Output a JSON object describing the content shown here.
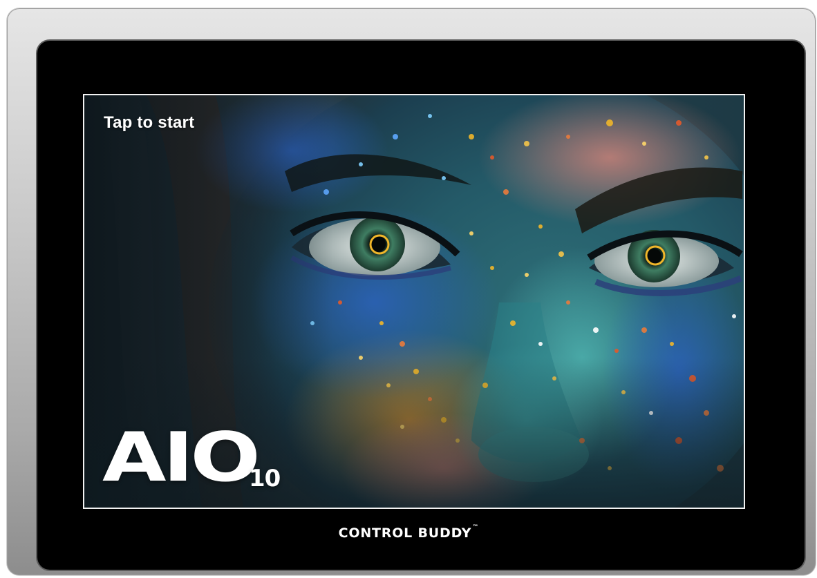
{
  "screen": {
    "prompt": "Tap to start",
    "model_name": "AIO",
    "model_size": "10"
  },
  "device": {
    "brand": "CONTROL BUDDY",
    "trademark": "™"
  },
  "colors": {
    "bezel": "#000000",
    "frame": "#b5b5b5",
    "screen_border": "#f2f2f2",
    "iris_ring": "#f0b62a"
  },
  "icons": {
    "eye_markers": [
      "eye-focus-ring-icon",
      "eye-focus-ring-icon"
    ]
  }
}
